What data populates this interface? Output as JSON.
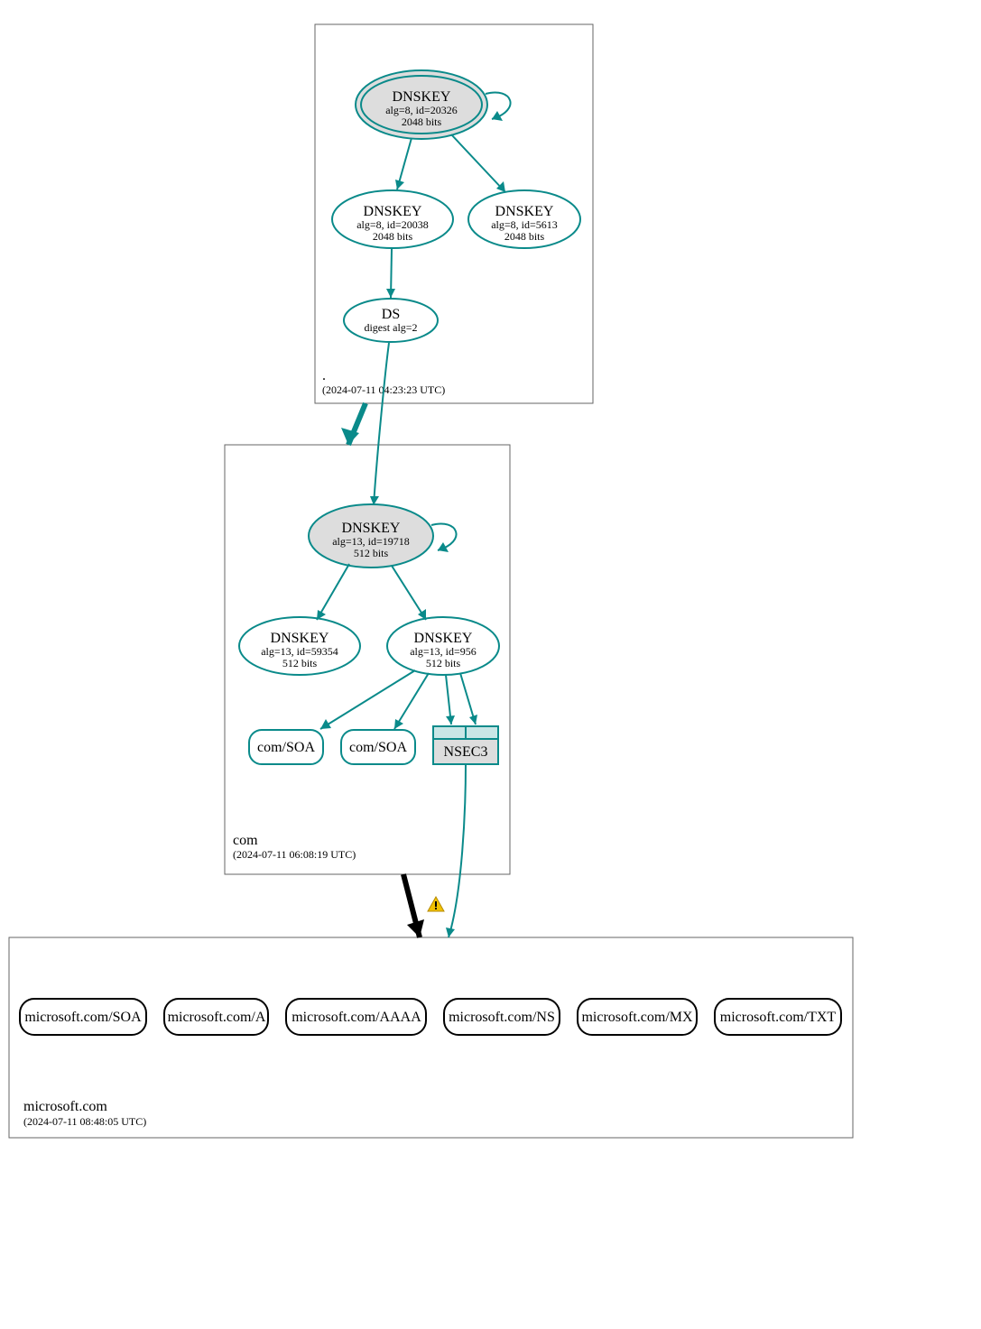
{
  "zones": {
    "root": {
      "label": ".",
      "timestamp": "(2024-07-11 04:23:23 UTC)"
    },
    "com": {
      "label": "com",
      "timestamp": "(2024-07-11 06:08:19 UTC)"
    },
    "ms": {
      "label": "microsoft.com",
      "timestamp": "(2024-07-11 08:48:05 UTC)"
    }
  },
  "nodes": {
    "root_ksk": {
      "title": "DNSKEY",
      "l1": "alg=8, id=20326",
      "l2": "2048 bits"
    },
    "root_zsk1": {
      "title": "DNSKEY",
      "l1": "alg=8, id=20038",
      "l2": "2048 bits"
    },
    "root_zsk2": {
      "title": "DNSKEY",
      "l1": "alg=8, id=5613",
      "l2": "2048 bits"
    },
    "root_ds": {
      "title": "DS",
      "l1": "digest alg=2"
    },
    "com_ksk": {
      "title": "DNSKEY",
      "l1": "alg=13, id=19718",
      "l2": "512 bits"
    },
    "com_zsk1": {
      "title": "DNSKEY",
      "l1": "alg=13, id=59354",
      "l2": "512 bits"
    },
    "com_zsk2": {
      "title": "DNSKEY",
      "l1": "alg=13, id=956",
      "l2": "512 bits"
    },
    "com_soa1": {
      "title": "com/SOA"
    },
    "com_soa2": {
      "title": "com/SOA"
    },
    "com_nsec3": {
      "title": "NSEC3"
    },
    "ms_soa": {
      "title": "microsoft.com/SOA"
    },
    "ms_a": {
      "title": "microsoft.com/A"
    },
    "ms_aaaa": {
      "title": "microsoft.com/AAAA"
    },
    "ms_ns": {
      "title": "microsoft.com/NS"
    },
    "ms_mx": {
      "title": "microsoft.com/MX"
    },
    "ms_txt": {
      "title": "microsoft.com/TXT"
    }
  },
  "icons": {
    "warning": "warning-icon"
  }
}
